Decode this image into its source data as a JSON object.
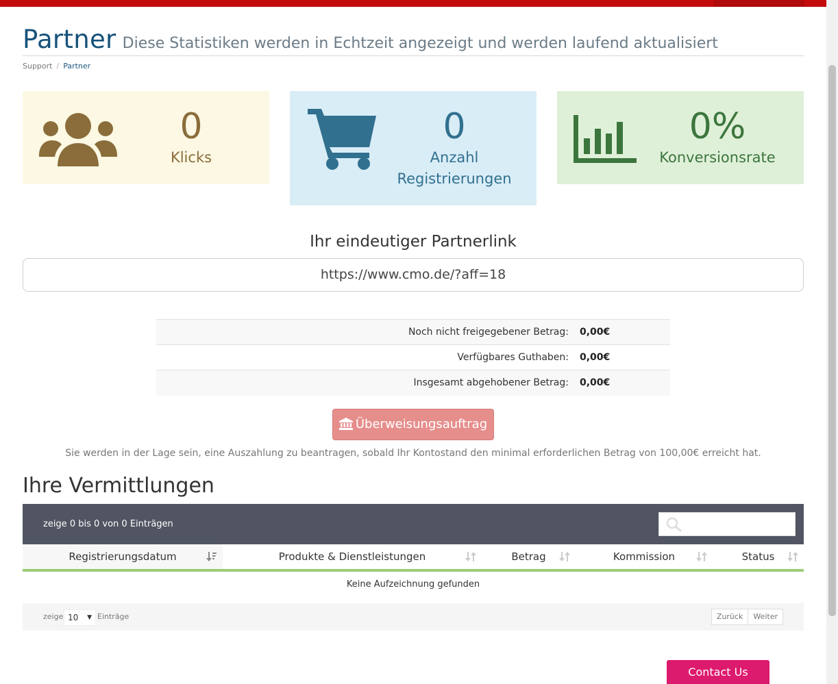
{
  "header": {
    "title": "Partner",
    "subtitle": "Diese Statistiken werden in Echtzeit angezeigt und werden laufend aktualisiert"
  },
  "breadcrumb": {
    "items": [
      "Support",
      "Partner"
    ]
  },
  "stats": {
    "klicks": {
      "value": "0",
      "label": "Klicks",
      "icon": "users-icon",
      "color": "#8a6d3b"
    },
    "registrations": {
      "value": "0",
      "label_line1": "Anzahl",
      "label_line2": "Registrierungen",
      "icon": "shopping-cart-icon",
      "color": "#31708f"
    },
    "conversion": {
      "value": "0%",
      "label": "Konversionsrate",
      "icon": "bar-chart-icon",
      "color": "#3c763d"
    }
  },
  "affiliate": {
    "title": "Ihr eindeutiger Partnerlink",
    "link": "https://www.cmo.de/?aff=18"
  },
  "balance": {
    "rows": [
      {
        "label": "Noch nicht freigegebener Betrag:",
        "value": "0,00€"
      },
      {
        "label": "Verfügbares Guthaben:",
        "value": "0,00€"
      },
      {
        "label": "Insgesamt abgehobener Betrag:",
        "value": "0,00€"
      }
    ]
  },
  "transfer": {
    "label": "Überweisungsauftrag",
    "icon": "bank-icon",
    "note": "Sie werden in der Lage sein, eine Auszahlung zu beantragen, sobald Ihr Kontostand den minimal erforderlichen Betrag von 100,00€ erreicht hat."
  },
  "referrals": {
    "title": "Ihre Vermittlungen",
    "info": "zeige 0 bis 0 von 0 Einträgen",
    "search_placeholder": "",
    "columns": [
      "Registrierungsdatum",
      "Produkte & Dienstleistungen",
      "Betrag",
      "Kommission",
      "Status"
    ],
    "empty": "Keine Aufzeichnung gefunden",
    "show_label": "zeige",
    "entries_label": "Einträge",
    "page_size": "10",
    "prev": "Zurück",
    "next": "Weiter"
  },
  "contact": {
    "label": "Contact Us"
  },
  "colors": {
    "topbar": "#c40b0b",
    "title": "#16527a",
    "table_header": "#515563",
    "column_accent": "#9ccc78",
    "transfer_button": "#e58e8c",
    "contact_button": "#dc1a6e"
  }
}
